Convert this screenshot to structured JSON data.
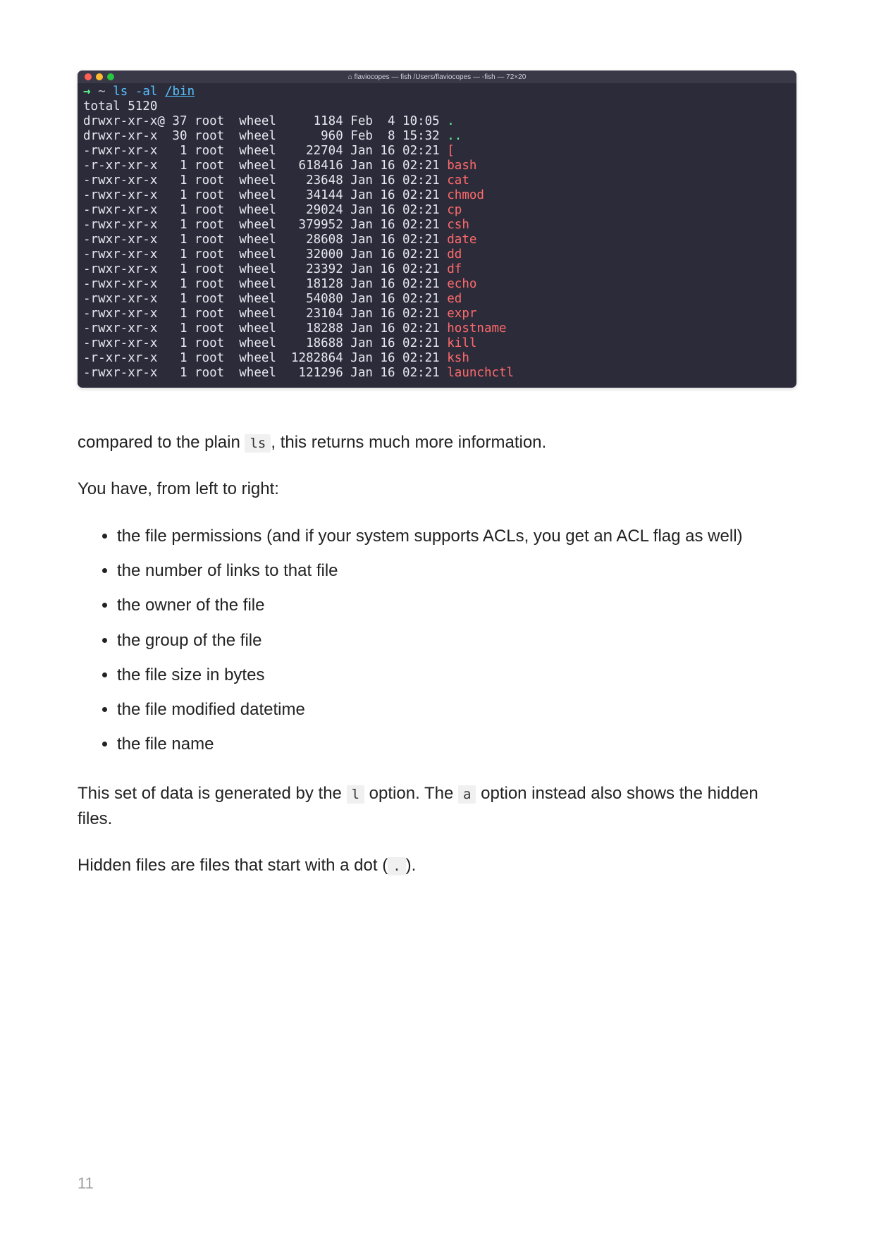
{
  "terminal": {
    "titlebar_text": "flaviocopes — fish  /Users/flaviocopes — -fish — 72×20",
    "prompt_arrow": "→",
    "prompt_tilde": "~",
    "cmd_ls": "ls",
    "cmd_flag": "-al",
    "cmd_path": "/bin",
    "total_line": "total 5120",
    "rows": [
      {
        "perm": "drwxr-xr-x@",
        "links": "37",
        "owner": "root",
        "group": "wheel",
        "size": "1184",
        "date": "Feb  4 10:05",
        "name": ".",
        "name_class": "fname-dot"
      },
      {
        "perm": "drwxr-xr-x ",
        "links": "30",
        "owner": "root",
        "group": "wheel",
        "size": "960",
        "date": "Feb  8 15:32",
        "name": "..",
        "name_class": "fname-dot"
      },
      {
        "perm": "-rwxr-xr-x ",
        "links": "1",
        "owner": "root",
        "group": "wheel",
        "size": "22704",
        "date": "Jan 16 02:21",
        "name": "[",
        "name_class": "fname"
      },
      {
        "perm": "-r-xr-xr-x ",
        "links": "1",
        "owner": "root",
        "group": "wheel",
        "size": "618416",
        "date": "Jan 16 02:21",
        "name": "bash",
        "name_class": "fname"
      },
      {
        "perm": "-rwxr-xr-x ",
        "links": "1",
        "owner": "root",
        "group": "wheel",
        "size": "23648",
        "date": "Jan 16 02:21",
        "name": "cat",
        "name_class": "fname"
      },
      {
        "perm": "-rwxr-xr-x ",
        "links": "1",
        "owner": "root",
        "group": "wheel",
        "size": "34144",
        "date": "Jan 16 02:21",
        "name": "chmod",
        "name_class": "fname"
      },
      {
        "perm": "-rwxr-xr-x ",
        "links": "1",
        "owner": "root",
        "group": "wheel",
        "size": "29024",
        "date": "Jan 16 02:21",
        "name": "cp",
        "name_class": "fname"
      },
      {
        "perm": "-rwxr-xr-x ",
        "links": "1",
        "owner": "root",
        "group": "wheel",
        "size": "379952",
        "date": "Jan 16 02:21",
        "name": "csh",
        "name_class": "fname"
      },
      {
        "perm": "-rwxr-xr-x ",
        "links": "1",
        "owner": "root",
        "group": "wheel",
        "size": "28608",
        "date": "Jan 16 02:21",
        "name": "date",
        "name_class": "fname"
      },
      {
        "perm": "-rwxr-xr-x ",
        "links": "1",
        "owner": "root",
        "group": "wheel",
        "size": "32000",
        "date": "Jan 16 02:21",
        "name": "dd",
        "name_class": "fname"
      },
      {
        "perm": "-rwxr-xr-x ",
        "links": "1",
        "owner": "root",
        "group": "wheel",
        "size": "23392",
        "date": "Jan 16 02:21",
        "name": "df",
        "name_class": "fname"
      },
      {
        "perm": "-rwxr-xr-x ",
        "links": "1",
        "owner": "root",
        "group": "wheel",
        "size": "18128",
        "date": "Jan 16 02:21",
        "name": "echo",
        "name_class": "fname"
      },
      {
        "perm": "-rwxr-xr-x ",
        "links": "1",
        "owner": "root",
        "group": "wheel",
        "size": "54080",
        "date": "Jan 16 02:21",
        "name": "ed",
        "name_class": "fname"
      },
      {
        "perm": "-rwxr-xr-x ",
        "links": "1",
        "owner": "root",
        "group": "wheel",
        "size": "23104",
        "date": "Jan 16 02:21",
        "name": "expr",
        "name_class": "fname"
      },
      {
        "perm": "-rwxr-xr-x ",
        "links": "1",
        "owner": "root",
        "group": "wheel",
        "size": "18288",
        "date": "Jan 16 02:21",
        "name": "hostname",
        "name_class": "fname"
      },
      {
        "perm": "-rwxr-xr-x ",
        "links": "1",
        "owner": "root",
        "group": "wheel",
        "size": "18688",
        "date": "Jan 16 02:21",
        "name": "kill",
        "name_class": "fname"
      },
      {
        "perm": "-r-xr-xr-x ",
        "links": "1",
        "owner": "root",
        "group": "wheel",
        "size": "1282864",
        "date": "Jan 16 02:21",
        "name": "ksh",
        "name_class": "fname"
      },
      {
        "perm": "-rwxr-xr-x ",
        "links": "1",
        "owner": "root",
        "group": "wheel",
        "size": "121296",
        "date": "Jan 16 02:21",
        "name": "launchctl",
        "name_class": "fname"
      }
    ]
  },
  "body": {
    "p1_before": "compared to the plain ",
    "p1_code": "ls",
    "p1_after": ", this returns much more information.",
    "p2": "You have, from left to right:",
    "list": [
      "the file permissions (and if your system supports ACLs, you get an ACL flag as well)",
      "the number of links to that file",
      "the owner of the file",
      "the group of the file",
      "the file size in bytes",
      "the file modified datetime",
      "the file name"
    ],
    "p3_a": "This set of data is generated by the ",
    "p3_code1": "l",
    "p3_b": " option. The ",
    "p3_code2": "a",
    "p3_c": " option instead also shows the hidden files.",
    "p4_a": "Hidden files are files that start with a dot (",
    "p4_code": ".",
    "p4_b": ")."
  },
  "page_number": "11"
}
